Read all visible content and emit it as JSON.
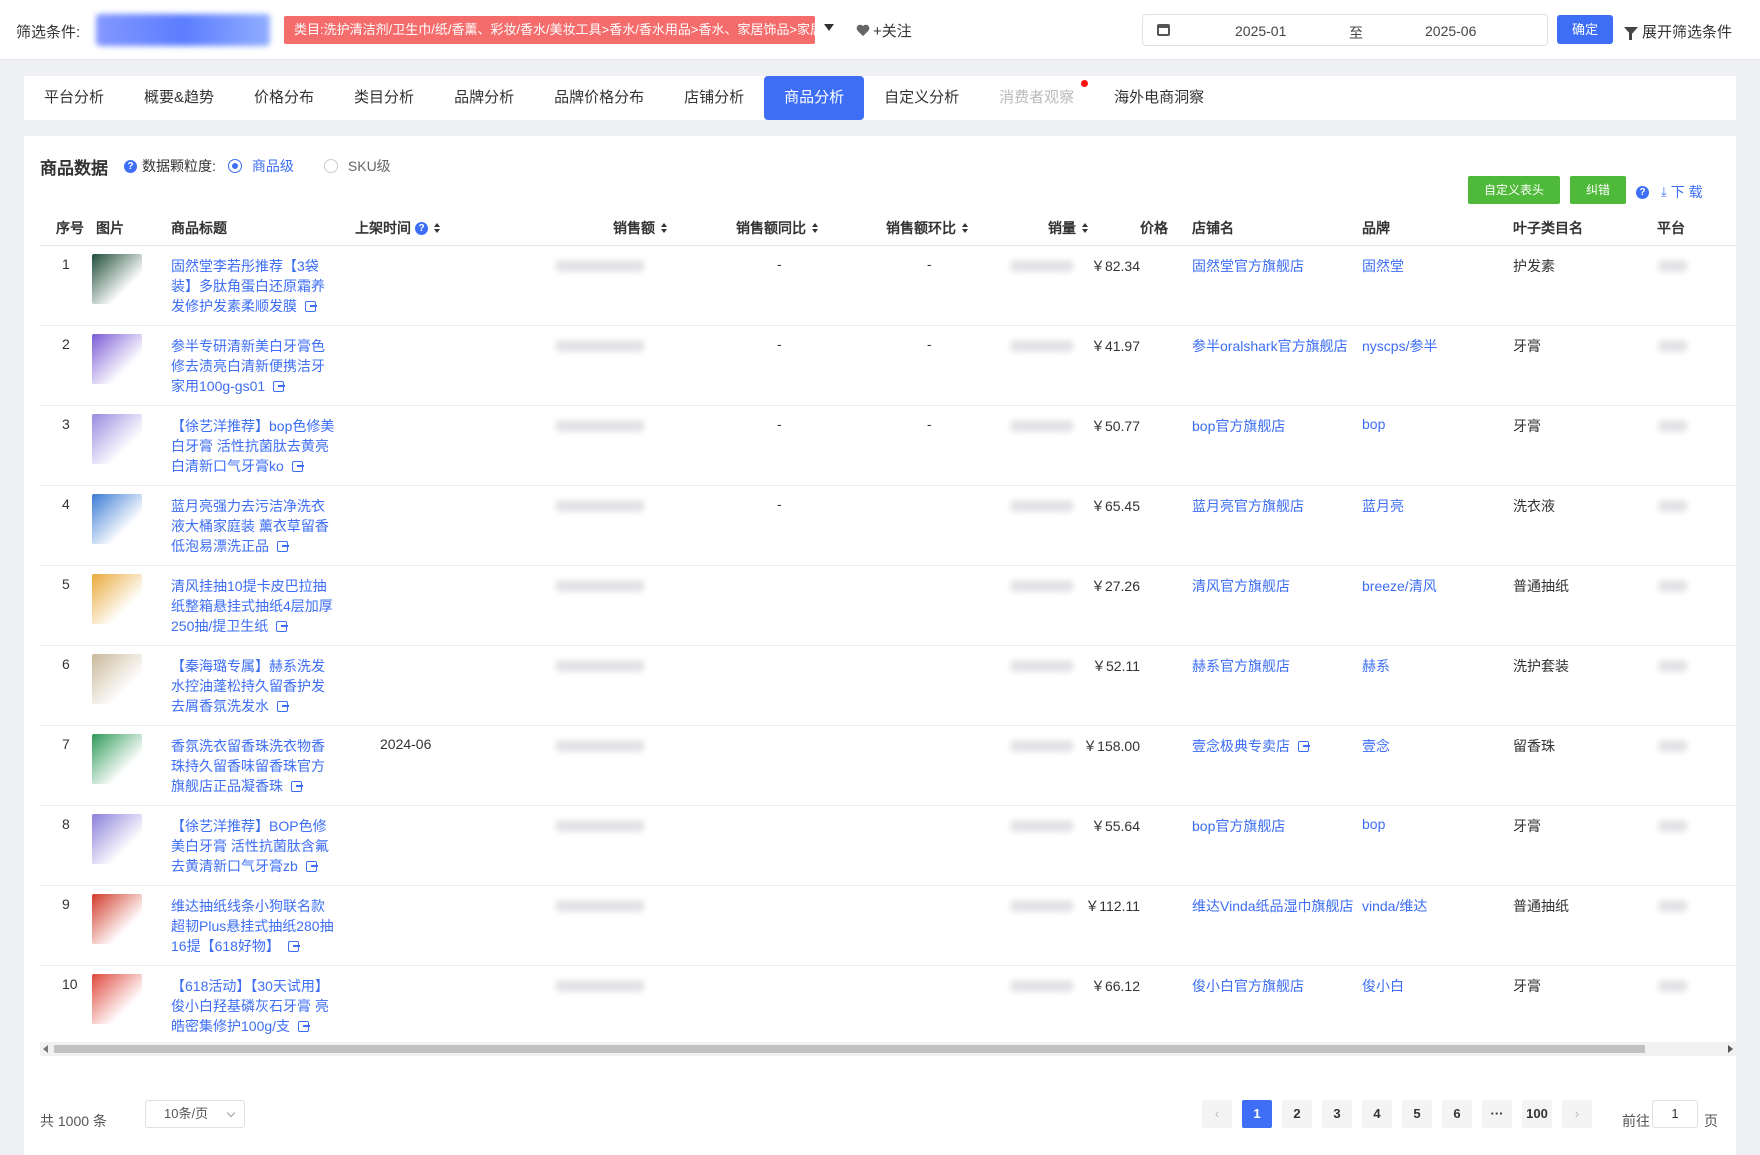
{
  "filter": {
    "label": "筛选条件:",
    "category": "类目:洗护清洁剂/卫生巾/纸/香薰、彩妆/香水/美妆工具>香水/香水用品>香水、家居饰品>家居香薰",
    "follow": "+关注",
    "date_start": "2025-01",
    "date_sep": "至",
    "date_end": "2025-06",
    "confirm": "确定",
    "expand": "展开筛选条件"
  },
  "tabs": [
    {
      "label": "平台分析",
      "state": "normal"
    },
    {
      "label": "概要&趋势",
      "state": "normal"
    },
    {
      "label": "价格分布",
      "state": "normal"
    },
    {
      "label": "类目分析",
      "state": "normal"
    },
    {
      "label": "品牌分析",
      "state": "normal"
    },
    {
      "label": "品牌价格分布",
      "state": "normal"
    },
    {
      "label": "店铺分析",
      "state": "normal"
    },
    {
      "label": "商品分析",
      "state": "active"
    },
    {
      "label": "自定义分析",
      "state": "normal"
    },
    {
      "label": "消费者观察",
      "state": "disabled"
    },
    {
      "label": "海外电商洞察",
      "state": "normal"
    }
  ],
  "panel": {
    "title": "商品数据",
    "granularity_label": "数据颗粒度:",
    "options": [
      "商品级",
      "SKU级"
    ],
    "selected": "商品级",
    "custom_header": "自定义表头",
    "correct": "纠错",
    "download": "下 载"
  },
  "columns": {
    "idx": "序号",
    "img": "图片",
    "title": "商品标题",
    "listed": "上架时间",
    "sales": "销售额",
    "yoy": "销售额同比",
    "mom": "销售额环比",
    "volume": "销量",
    "price": "价格",
    "shop": "店铺名",
    "brand": "品牌",
    "leaf": "叶子类目名",
    "platform": "平台"
  },
  "rows": [
    {
      "idx": "1",
      "title": "固然堂李若彤推荐【3袋装】多肽角蛋白还原霜养发修护发素柔顺发膜",
      "listed": "",
      "yoy": "-",
      "mom": "-",
      "price": "￥82.34",
      "shop": "固然堂官方旗舰店",
      "shop_ext": false,
      "brand": "固然堂",
      "leaf": "护发素",
      "thumb": "#1f4d3a"
    },
    {
      "idx": "2",
      "title": "参半专研清新美白牙膏色修去渍亮白清新便携洁牙家用100g-gs01",
      "listed": "",
      "yoy": "-",
      "mom": "-",
      "price": "￥41.97",
      "shop": "参半oralshark官方旗舰店",
      "shop_ext": false,
      "brand": "nyscps/参半",
      "leaf": "牙膏",
      "thumb": "#7b5cd6"
    },
    {
      "idx": "3",
      "title": "【徐艺洋推荐】bop色修美白牙膏 活性抗菌肽去黄亮白清新口气牙膏ko",
      "listed": "",
      "yoy": "-",
      "mom": "-",
      "price": "￥50.77",
      "shop": "bop官方旗舰店",
      "shop_ext": false,
      "brand": "bop",
      "leaf": "牙膏",
      "thumb": "#9a8be0"
    },
    {
      "idx": "4",
      "title": "蓝月亮强力去污洁净洗衣液大桶家庭装 薰衣草留香低泡易漂洗正品",
      "listed": "",
      "yoy": "-",
      "mom": "",
      "price": "￥65.45",
      "shop": "蓝月亮官方旗舰店",
      "shop_ext": false,
      "brand": "蓝月亮",
      "leaf": "洗衣液",
      "thumb": "#3a7bd5"
    },
    {
      "idx": "5",
      "title": "清风挂抽10提卡皮巴拉抽纸整箱悬挂式抽纸4层加厚250抽/提卫生纸",
      "listed": "",
      "yoy": "",
      "mom": "",
      "price": "￥27.26",
      "shop": "清风官方旗舰店",
      "shop_ext": false,
      "brand": "breeze/清风",
      "leaf": "普通抽纸",
      "thumb": "#e9a93a"
    },
    {
      "idx": "6",
      "title": "【秦海璐专属】赫系洗发水控油蓬松持久留香护发去屑香氛洗发水",
      "listed": "",
      "yoy": "",
      "mom": "",
      "price": "￥52.11",
      "shop": "赫系官方旗舰店",
      "shop_ext": false,
      "brand": "赫系",
      "leaf": "洗护套装",
      "thumb": "#c9b89a"
    },
    {
      "idx": "7",
      "title": "香氛洗衣留香珠洗衣物香珠持久留香味留香珠官方旗舰店正品凝香珠",
      "listed": "2024-06",
      "yoy": "",
      "mom": "",
      "price": "￥158.00",
      "shop": "壹念极典专卖店",
      "shop_ext": true,
      "brand": "壹念",
      "leaf": "留香珠",
      "thumb": "#2f9a5a"
    },
    {
      "idx": "8",
      "title": "【徐艺洋推荐】BOP色修美白牙膏 活性抗菌肽含氟去黄清新口气牙膏zb",
      "listed": "",
      "yoy": "",
      "mom": "",
      "price": "￥55.64",
      "shop": "bop官方旗舰店",
      "shop_ext": false,
      "brand": "bop",
      "leaf": "牙膏",
      "thumb": "#8a7fd9"
    },
    {
      "idx": "9",
      "title": "维达抽纸线条小狗联名款超韧Plus悬挂式抽纸280抽16提【618好物】",
      "listed": "",
      "yoy": "",
      "mom": "",
      "price": "￥112.11",
      "shop": "维达Vinda纸品湿巾旗舰店",
      "shop_ext": false,
      "brand": "vinda/维达",
      "leaf": "普通抽纸",
      "thumb": "#d23a2a"
    },
    {
      "idx": "10",
      "title": "【618活动】【30天试用】俊小白羟基磷灰石牙膏 亮皓密集修护100g/支",
      "listed": "",
      "yoy": "",
      "mom": "",
      "price": "￥66.12",
      "shop": "俊小白官方旗舰店",
      "shop_ext": false,
      "brand": "俊小白",
      "leaf": "牙膏",
      "thumb": "#e0483c"
    }
  ],
  "pagination": {
    "total": "共 1000 条",
    "page_size": "10条/页",
    "pages": [
      "1",
      "2",
      "3",
      "4",
      "5",
      "6",
      "···",
      "100"
    ],
    "current": "1",
    "goto_prefix": "前往",
    "goto_value": "1",
    "goto_suffix": "页"
  },
  "colors": {
    "accent": "#3d6ef5",
    "danger": "#f56c6c",
    "success": "#4fba3a"
  }
}
